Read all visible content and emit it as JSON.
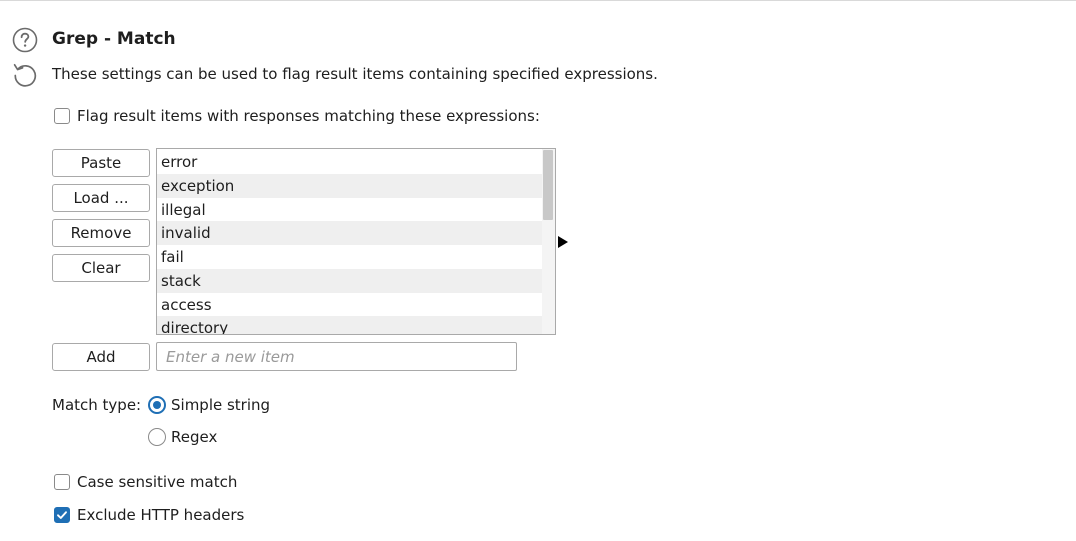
{
  "section": {
    "title": "Grep - Match",
    "description": "These settings can be used to flag result items containing specified expressions."
  },
  "icons": {
    "help": "help-circle-icon",
    "reset": "reset-icon",
    "expand": "triangle-right-icon",
    "check": "check-icon"
  },
  "flag_checkbox": {
    "label": "Flag result items with responses matching these expressions:",
    "checked": false
  },
  "buttons": {
    "paste": "Paste",
    "load": "Load ...",
    "remove": "Remove",
    "clear": "Clear",
    "add": "Add"
  },
  "expressions": [
    "error",
    "exception",
    "illegal",
    "invalid",
    "fail",
    "stack",
    "access",
    "directory"
  ],
  "new_item": {
    "placeholder": "Enter a new item",
    "value": ""
  },
  "match_type": {
    "label": "Match type:",
    "options": [
      {
        "label": "Simple string",
        "selected": true
      },
      {
        "label": "Regex",
        "selected": false
      }
    ]
  },
  "options": {
    "case_sensitive": {
      "label": "Case sensitive match",
      "checked": false
    },
    "exclude_headers": {
      "label": "Exclude HTTP headers",
      "checked": true
    }
  },
  "colors": {
    "accent": "#1f6fb5",
    "border": "#a9a9a9",
    "row_alt": "#efefef",
    "text": "#1e1e1e"
  }
}
